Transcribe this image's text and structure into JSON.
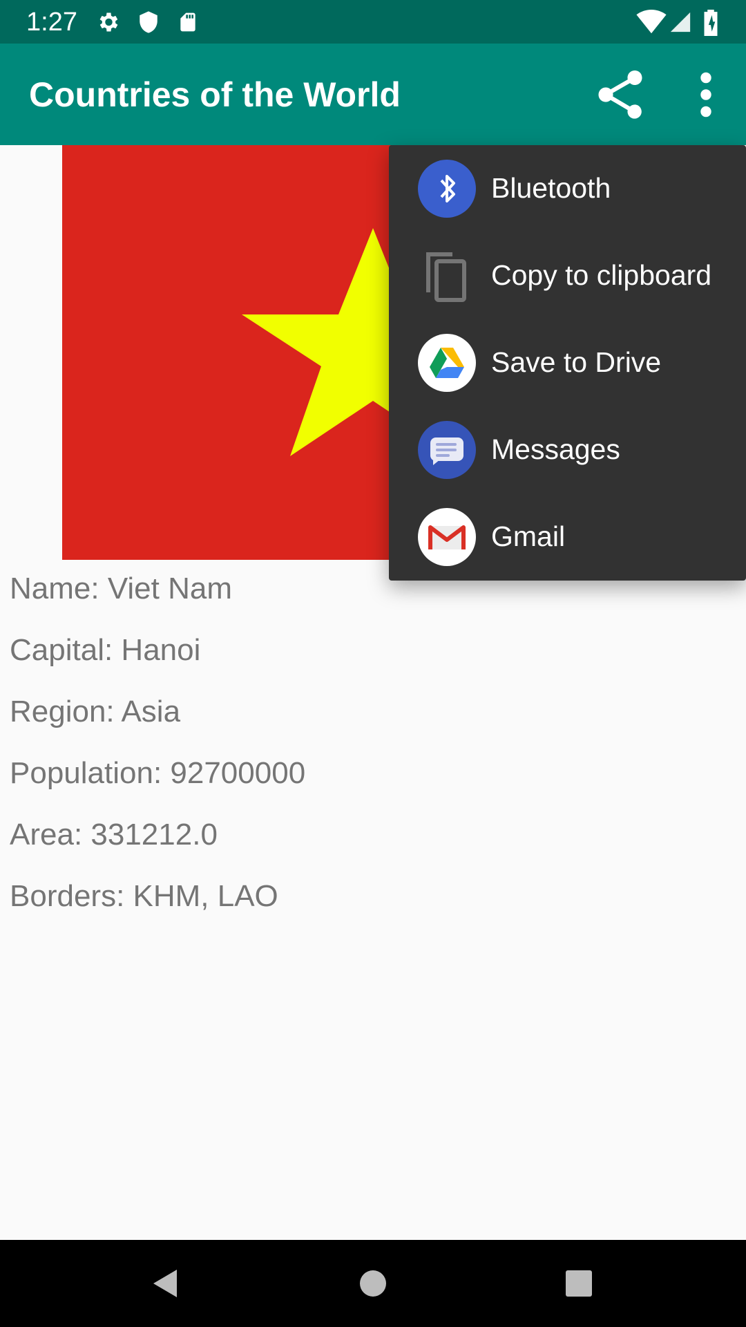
{
  "status_bar": {
    "time": "1:27",
    "left_icons": [
      "gear-icon",
      "shield-icon",
      "sd-card-icon"
    ],
    "right_icons": [
      "wifi-icon",
      "cell-signal-icon",
      "battery-icon"
    ]
  },
  "app_bar": {
    "title": "Countries of the World",
    "actions": [
      "share-icon",
      "more-vert-icon"
    ]
  },
  "flag": {
    "country": "Viet Nam",
    "background_color": "#da251d",
    "star_color": "#f1ff00"
  },
  "details": {
    "name": "Name: Viet Nam",
    "capital": "Capital: Hanoi",
    "region": "Region: Asia",
    "population": "Population: 92700000",
    "area": "Area: 331212.0",
    "borders": "Borders: KHM, LAO"
  },
  "share_menu": {
    "items": [
      {
        "label": "Bluetooth",
        "icon": "bluetooth-icon"
      },
      {
        "label": "Copy to clipboard",
        "icon": "copy-icon"
      },
      {
        "label": "Save to Drive",
        "icon": "drive-icon"
      },
      {
        "label": "Messages",
        "icon": "messages-icon"
      },
      {
        "label": "Gmail",
        "icon": "gmail-icon"
      }
    ]
  },
  "nav_bar": {
    "buttons": [
      "back-icon",
      "home-icon",
      "recents-icon"
    ]
  },
  "colors": {
    "status_bar": "#00695c",
    "app_bar": "#00897b",
    "menu_background": "#323232",
    "detail_text": "#757575"
  }
}
